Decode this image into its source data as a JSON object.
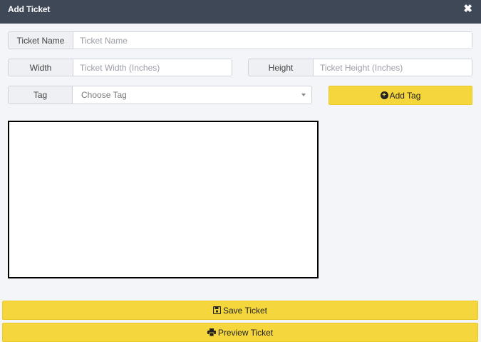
{
  "header": {
    "title": "Add Ticket",
    "close_icon": "close-icon"
  },
  "form": {
    "ticket_name": {
      "label": "Ticket Name",
      "placeholder": "Ticket Name",
      "value": ""
    },
    "width": {
      "label": "Width",
      "placeholder": "Ticket Width (Inches)",
      "value": ""
    },
    "height": {
      "label": "Height",
      "placeholder": "Ticket Height (Inches)",
      "value": ""
    },
    "tag": {
      "label": "Tag",
      "selected": "Choose Tag"
    },
    "add_tag_label": "Add Tag"
  },
  "buttons": {
    "save_label": "Save Ticket",
    "preview_label": "Preview Ticket"
  },
  "colors": {
    "header": "#3f4857",
    "accent": "#f5d63d",
    "background": "#f4f5f8"
  }
}
